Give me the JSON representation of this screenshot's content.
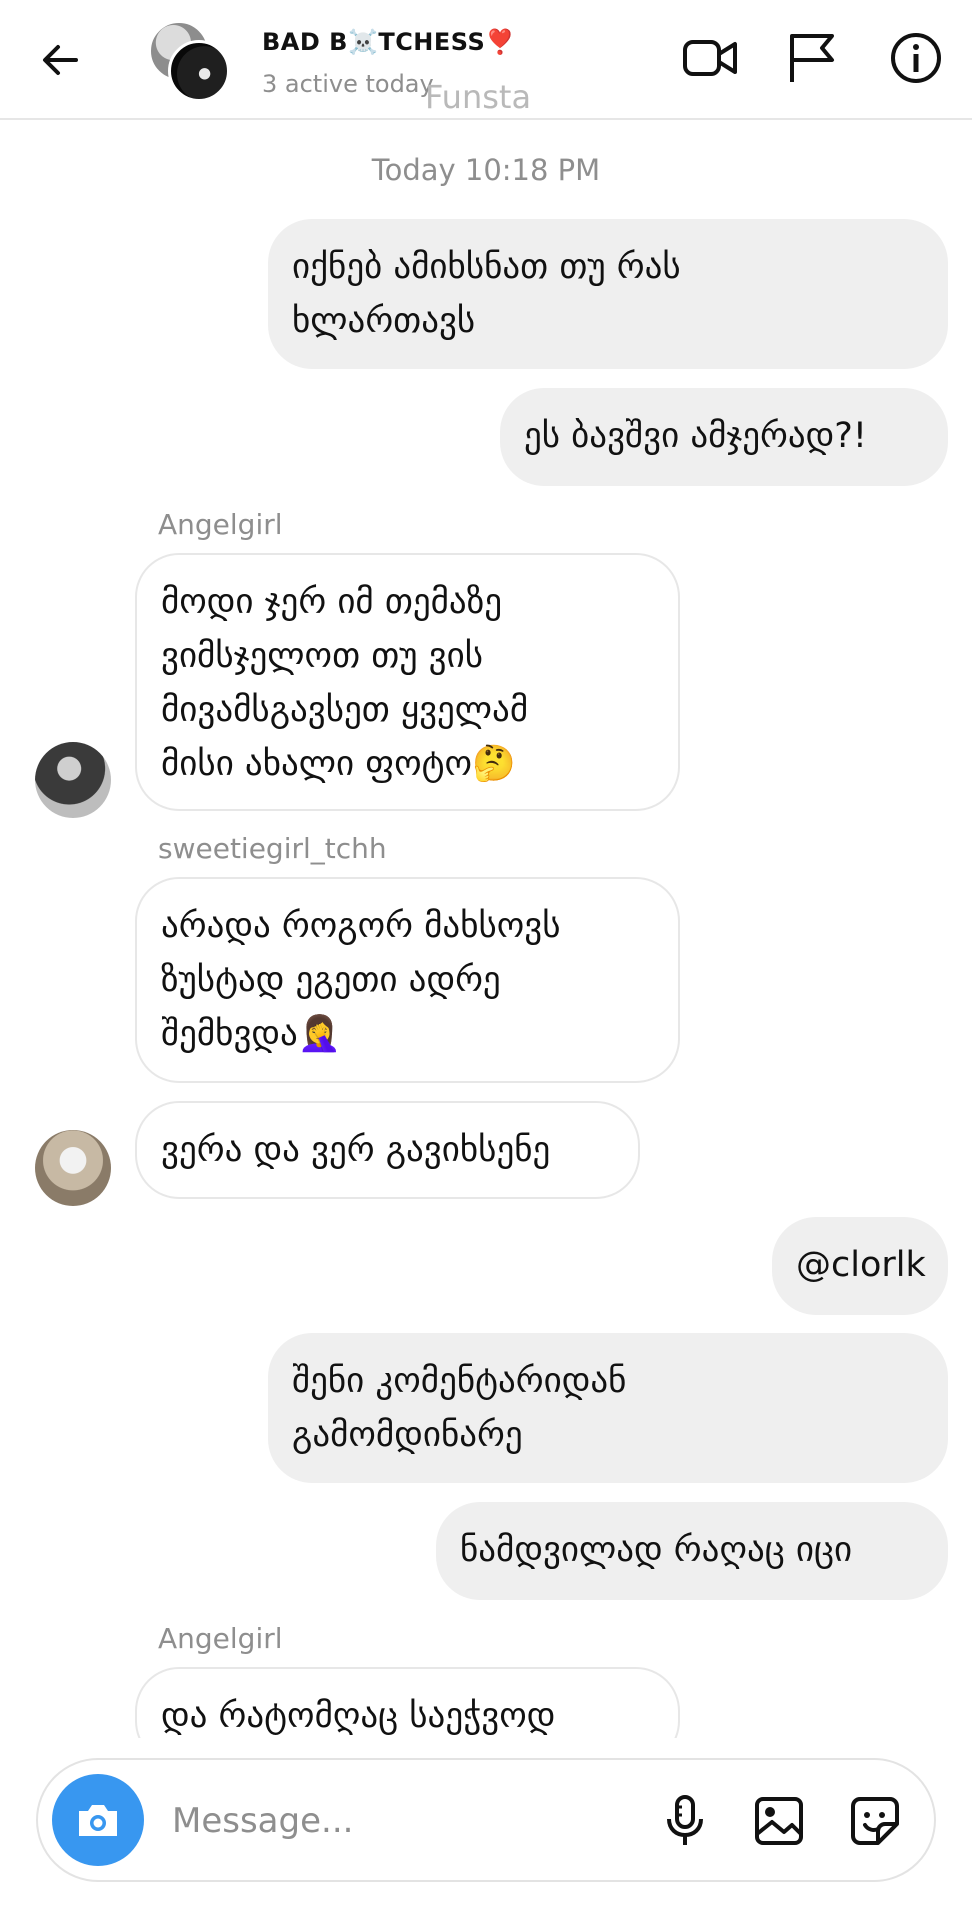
{
  "header": {
    "title": "BAD B☠️TCHESS❣️",
    "subtitle": "3 active today",
    "watermark": "Funsta"
  },
  "timestamp": "Today 10:18 PM",
  "messages": [
    {
      "side": "out",
      "text": "იქნებ ამიხსნათ თუ რას\nხლართავს"
    },
    {
      "side": "out",
      "text": "ეს ბავშვი ამჯერად?!"
    },
    {
      "side": "in",
      "sender": "Angelgirl",
      "text": "მოდი ჯერ იმ თემაზე\nვიმსჯელოთ თუ ვის\nმივამსგავსეთ ყველამ\nმისი ახალი ფოტო🤔"
    },
    {
      "side": "in",
      "sender": "sweetiegirl_tchh",
      "text": "არადა როგორ მახსოვს\nზუსტად ეგეთი ადრე\nშემხვდა🤦‍♀️"
    },
    {
      "side": "in",
      "text": "ვერა და ვერ გავიხსენე"
    },
    {
      "side": "out",
      "text": "@clorlk"
    },
    {
      "side": "out",
      "text": "შენი კომენტარიდან\nგამომდინარე"
    },
    {
      "side": "out",
      "text": "ნამდვილად რაღაც იცი"
    },
    {
      "side": "in",
      "sender": "Angelgirl",
      "text": "და რატომღაც საეჭვოდ"
    }
  ],
  "composer": {
    "placeholder": "Message..."
  },
  "icons": {
    "back": "arrow-left-icon",
    "video": "video-camera-icon",
    "flag": "flag-icon",
    "info": "info-icon",
    "camera": "camera-icon",
    "mic": "microphone-icon",
    "gallery": "image-icon",
    "sticker": "sticker-icon"
  },
  "colors": {
    "accent": "#3897f0",
    "outgoing_bubble": "#efefef",
    "muted_text": "#8e8e8e"
  }
}
